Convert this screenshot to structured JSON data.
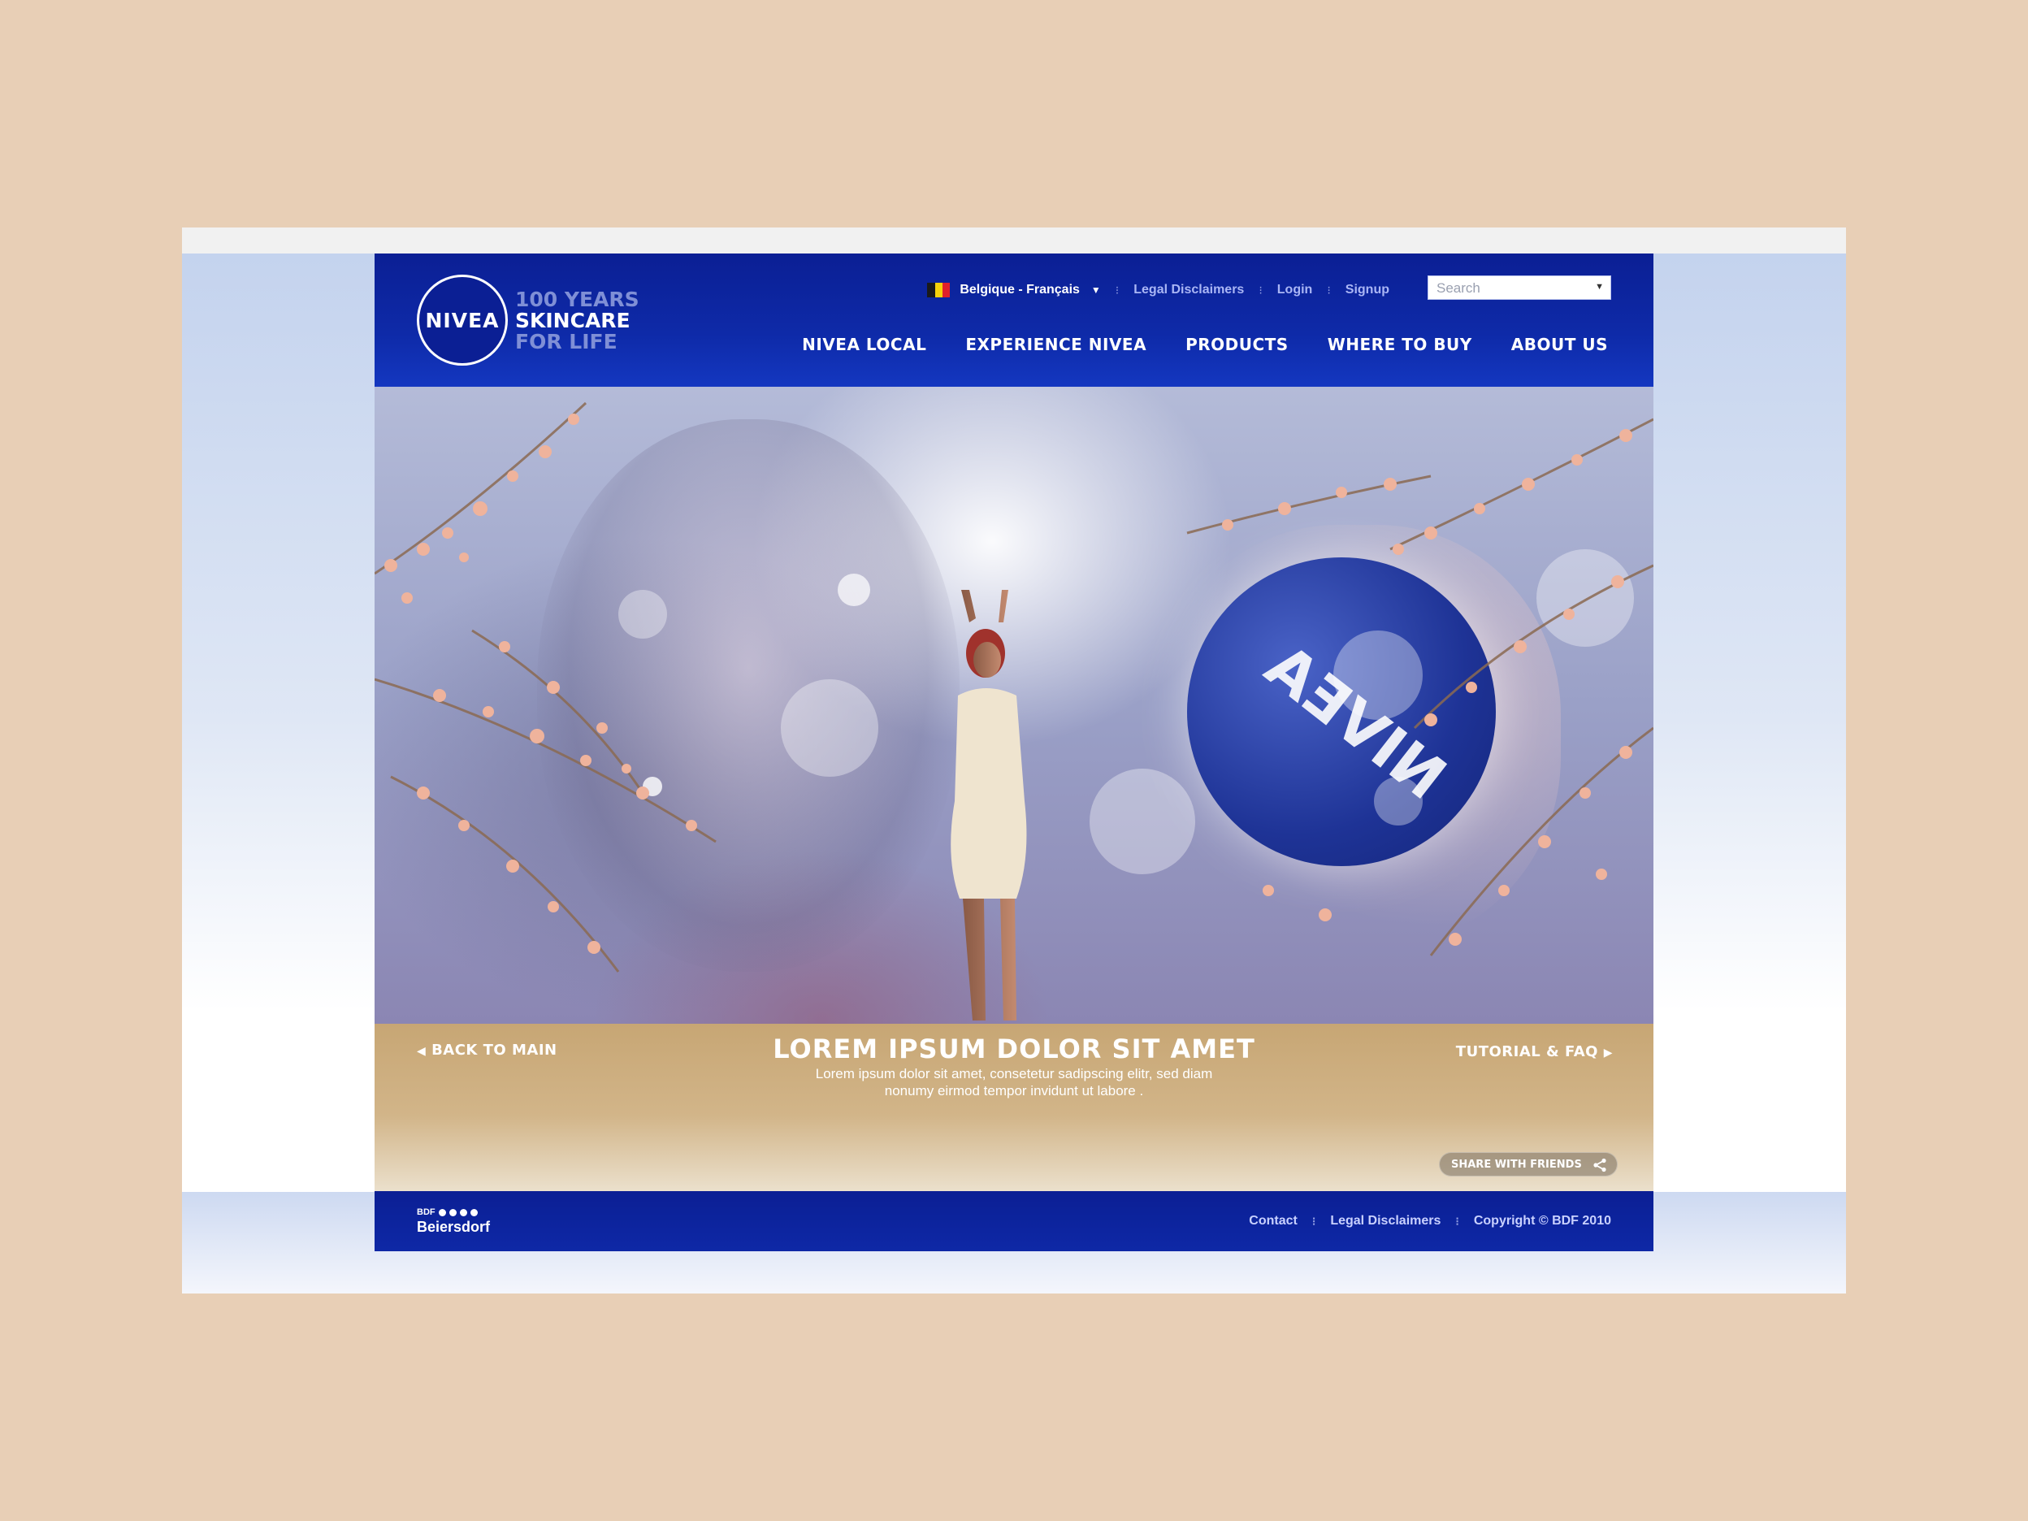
{
  "header": {
    "logo_text": "NIVEA",
    "tagline": [
      "100 YEARS",
      "SKINCARE",
      "FOR LIFE"
    ],
    "utility": {
      "language": "Belgique - Français",
      "links": [
        "Legal Disclaimers",
        "Login",
        "Signup"
      ]
    },
    "search": {
      "placeholder": "Search"
    },
    "nav": [
      "NIVEA LOCAL",
      "EXPERIENCE NIVEA",
      "PRODUCTS",
      "WHERE TO BUY",
      "ABOUT US"
    ]
  },
  "hero": {
    "jar_text": "NIVEA"
  },
  "banner": {
    "back_label": "BACK TO MAIN",
    "title": "LOREM IPSUM DOLOR SIT AMET",
    "text": "Lorem ipsum dolor sit amet, consetetur sadipscing elitr, sed diam nonumy eirmod tempor invidunt ut labore .",
    "tutorial_label": "TUTORIAL & FAQ",
    "share_label": "SHARE WITH FRIENDS"
  },
  "footer": {
    "brand_small": "BDF",
    "brand": "Beiersdorf",
    "links": [
      "Contact",
      "Legal Disclaimers",
      "Copyright © BDF 2010"
    ]
  },
  "colors": {
    "brand_blue": "#0b1f94",
    "gold_band": "#c7a674",
    "page_bg": "#e8cfb6"
  },
  "icons": {
    "flag": "belgium-flag-icon",
    "dropdown": "chevron-down-icon",
    "back": "chevron-left-icon",
    "forward": "chevron-right-icon",
    "share": "share-icon"
  }
}
